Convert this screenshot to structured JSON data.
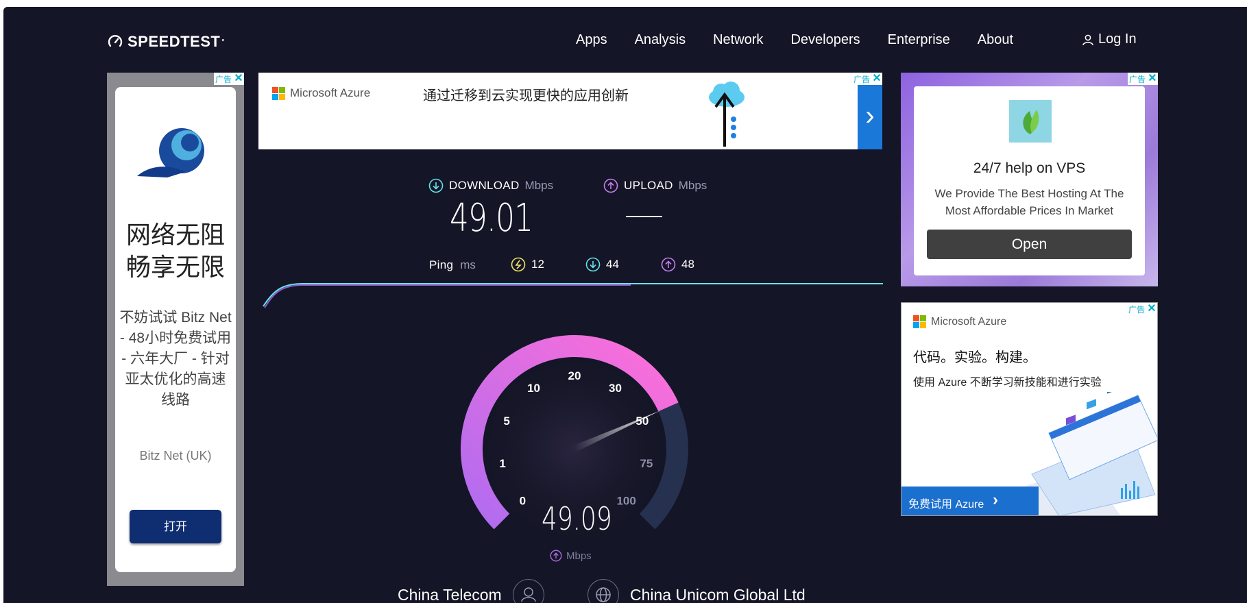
{
  "header": {
    "logo_text": "SPEEDTEST",
    "nav": [
      "Apps",
      "Analysis",
      "Network",
      "Developers",
      "Enterprise",
      "About"
    ],
    "login_label": "Log In"
  },
  "ads": {
    "label": "广告",
    "close_glyph": "✕",
    "left": {
      "headline_1": "网络无阻",
      "headline_2": "畅享无限",
      "body": "不妨试试 Bitz Net - 48小时免费试用 - 六年大厂 - 针对亚太优化的高速线路",
      "brand": "Bitz Net (UK)",
      "button": "打开"
    },
    "top": {
      "brand": "Microsoft Azure",
      "text": "通过迁移到云实现更快的应用创新",
      "arrow": "›"
    },
    "right1": {
      "title": "24/7 help on VPS",
      "desc": "We Provide The Best Hosting At The Most Affordable Prices In Market",
      "button": "Open"
    },
    "right2": {
      "brand": "Microsoft Azure",
      "headline": "代码。实验。构建。",
      "subline": "使用 Azure 不断学习新技能和进行实验",
      "cta": "免费试用 Azure",
      "cta_arrow": "›"
    }
  },
  "results": {
    "download_label": "DOWNLOAD",
    "upload_label": "UPLOAD",
    "unit": "Mbps",
    "download_value": "49.01",
    "upload_value": "——",
    "ping_label": "Ping",
    "ping_unit": "ms",
    "ping_idle": "12",
    "ping_down": "44",
    "ping_up": "48"
  },
  "gauge": {
    "ticks": [
      "0",
      "1",
      "5",
      "10",
      "20",
      "30",
      "50",
      "75",
      "100"
    ],
    "value": "49.09",
    "unit": "Mbps",
    "current_speed": 49.09,
    "colors": {
      "start": "#b06cf0",
      "end": "#ff6fd8",
      "track": "#263150"
    }
  },
  "servers": {
    "isp": "China Telecom",
    "host": "China Unicom Global Ltd"
  }
}
